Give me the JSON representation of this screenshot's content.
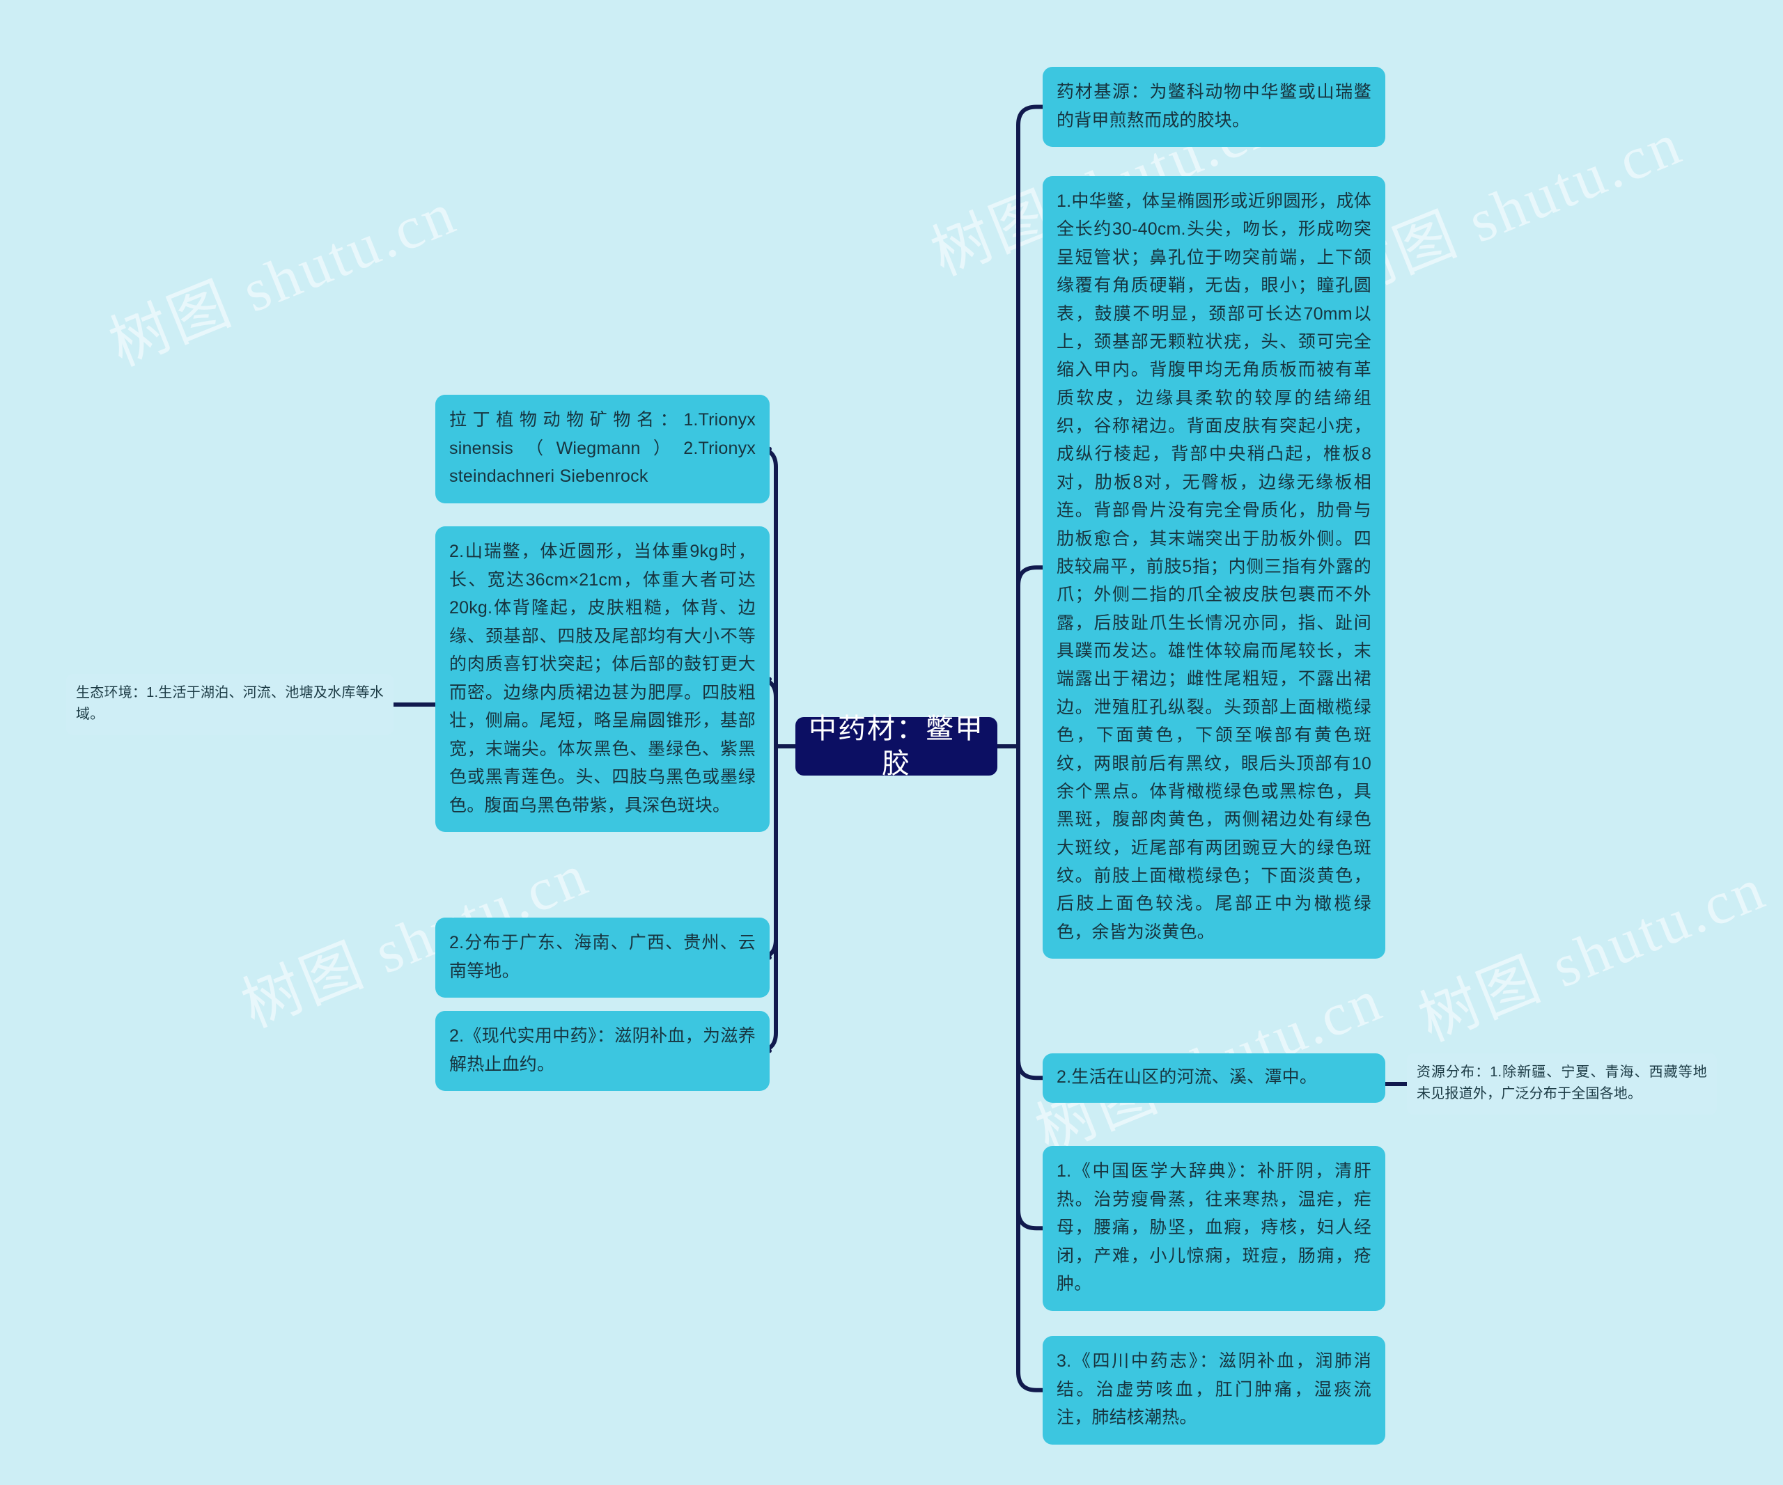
{
  "page": {
    "background_color": "#cdeef5",
    "node_color": "#3cc6e0",
    "leaf_color": "#cfeef6",
    "root_color": "#0c0f63",
    "link_color": "#111a4e",
    "watermark_text": "树图 shutu.cn"
  },
  "root": {
    "label": "中药材：鳖甲胶"
  },
  "left_branches": [
    {
      "id": "latin",
      "label": "拉丁植物动物矿物名：1.Trionyx sinensis（Wiegmann）2.Trionyx steindachneri Siebenrock"
    },
    {
      "id": "shanrui",
      "label": "2.山瑞鳖，体近圆形，当体重9kg时，长、宽达36cm×21cm，体重大者可达20kg.体背隆起，皮肤粗糙，体背、边缘、颈基部、四肢及尾部均有大小不等的肉质喜钉状突起；体后部的鼓钉更大而密。边缘内质裙边甚为肥厚。四肢粗壮，侧扁。尾短，略呈扁圆锥形，基部宽，末端尖。体灰黑色、墨绿色、紫黑色或黑青莲色。头、四肢乌黑色或墨绿色。腹面乌黑色带紫，具深色斑块。"
    },
    {
      "id": "dist-left",
      "label": "2.分布于广东、海南、广西、贵州、云南等地。"
    },
    {
      "id": "book2",
      "label": "2.《现代实用中药》：滋阴补血，为滋养解热止血约。"
    }
  ],
  "left_leaves": [
    {
      "id": "eco",
      "label": "生态环境：1.生活于湖泊、河流、池塘及水库等水域。"
    }
  ],
  "right_branches": [
    {
      "id": "source",
      "label": "药材基源：为鳖科动物中华鳖或山瑞鳖的背甲煎熬而成的胶块。"
    },
    {
      "id": "zhonghua",
      "label": "1.中华鳖，体呈椭圆形或近卵圆形，成体全长约30-40cm.头尖，吻长，形成吻突呈短管状；鼻孔位于吻突前端，上下颌缘覆有角质硬鞘，无齿，眼小；瞳孔圆表，鼓膜不明显，颈部可长达70mm以上，颈基部无颗粒状疣，头、颈可完全缩入甲内。背腹甲均无角质板而被有革质软皮，边缘具柔软的较厚的结缔组织，谷称裙边。背面皮肤有突起小疣，成纵行棱起，背部中央稍凸起，椎板8对，肋板8对，无臀板，边缘无缘板相连。背部骨片没有完全骨质化，肋骨与肋板愈合，其末端突出于肋板外侧。四肢较扁平，前肢5指；内侧三指有外露的爪；外侧二指的爪全被皮肤包裹而不外露，后肢趾爪生长情况亦同，指、趾间具蹼而发达。雄性体较扁而尾较长，末端露出于裙边；雌性尾粗短，不露出裙边。泄殖肛孔纵裂。头颈部上面橄榄绿色，下面黄色，下颌至喉部有黄色斑纹，两眼前后有黑纹，眼后头顶部有10余个黑点。体背橄榄绿色或黑棕色，具黑斑，腹部肉黄色，两侧裙边处有绿色大斑纹，近尾部有两团豌豆大的绿色斑纹。前肢上面橄榄绿色；下面淡黄色，后肢上面色较浅。尾部正中为橄榄绿色，余皆为淡黄色。"
    },
    {
      "id": "habitat2",
      "label": "2.生活在山区的河流、溪、潭中。"
    },
    {
      "id": "book1",
      "label": "1.《中国医学大辞典》：补肝阴，清肝热。治劳瘦骨蒸，往来寒热，温疟，疟母，腰痛，胁坚，血瘕，痔核，妇人经闭，产难，小儿惊痫，斑痘，肠痈，疮肿。"
    },
    {
      "id": "book3",
      "label": "3.《四川中药志》：滋阴补血，润肺消结。治虚劳咳血，肛门肿痛，湿痰流注，肺结核潮热。"
    }
  ],
  "right_leaves": [
    {
      "id": "resource",
      "label": "资源分布：1.除新疆、宁夏、青海、西藏等地未见报道外，广泛分布于全国各地。"
    }
  ]
}
